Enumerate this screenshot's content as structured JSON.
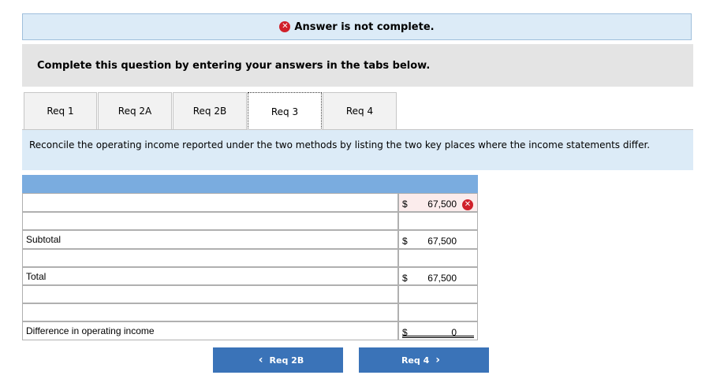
{
  "banner": {
    "icon": "error-x-icon",
    "text": "Answer is not complete."
  },
  "instructions": "Complete this question by entering your answers in the tabs below.",
  "tabs": [
    {
      "label": "Req 1"
    },
    {
      "label": "Req 2A"
    },
    {
      "label": "Req 2B"
    },
    {
      "label": "Req 3",
      "active": true
    },
    {
      "label": "Req 4"
    }
  ],
  "question": "Reconcile the operating income reported under the two methods by listing the two key places where the income statements differ.",
  "table": {
    "rows": [
      {
        "label": "",
        "currency": "$",
        "amount": "67,500",
        "error": true
      },
      {
        "label": "",
        "currency": "",
        "amount": ""
      },
      {
        "label": "Subtotal",
        "currency": "$",
        "amount": "67,500"
      },
      {
        "label": "",
        "currency": "",
        "amount": ""
      },
      {
        "label": "Total",
        "currency": "$",
        "amount": "67,500"
      },
      {
        "label": "",
        "currency": "",
        "amount": ""
      },
      {
        "label": "",
        "currency": "",
        "amount": ""
      },
      {
        "label": "Difference in operating income",
        "currency": "$",
        "amount": "0"
      }
    ]
  },
  "nav": {
    "prev_label": "Req 2B",
    "next_label": "Req 4",
    "prev_icon": "chevron-left-icon",
    "next_icon": "chevron-right-icon"
  },
  "colors": {
    "header": "#7aacdf",
    "banner_bg": "#dcebf7",
    "button": "#3a73b8",
    "error": "#d0202a"
  }
}
